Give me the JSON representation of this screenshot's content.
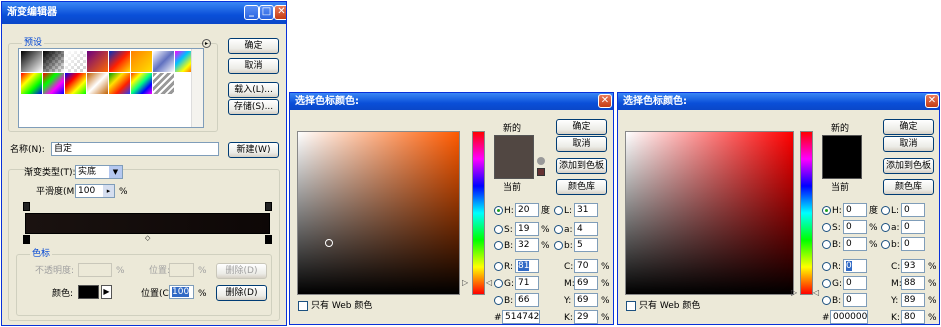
{
  "gradient_editor": {
    "title": "渐变编辑器",
    "presets_label": "预设",
    "buttons": {
      "ok": "确定",
      "cancel": "取消",
      "load": "载入(L)...",
      "save": "存储(S)...",
      "new": "新建(W)"
    },
    "name_label": "名称(N):",
    "name_value": "自定",
    "type_label": "渐变类型(T):",
    "type_value": "实底",
    "smooth_label": "平滑度(M):",
    "smooth_value": "100",
    "smooth_unit": "%",
    "stops_group": "色标",
    "opacity_label": "不透明度:",
    "opacity_unit": "%",
    "position_label": "位置:",
    "position_unit": "%",
    "delete_label": "删除(D)",
    "color_label": "颜色:",
    "color_position_label": "位置(C):",
    "color_position_value": "100",
    "color_position_unit": "%",
    "delete2_label": "删除(D)"
  },
  "picker1": {
    "title": "选择色标颜色:",
    "new_label": "新的",
    "current_label": "当前",
    "new_color": "#514742",
    "current_color": "#514742",
    "buttons": {
      "ok": "确定",
      "cancel": "取消",
      "swatches": "添加到色板",
      "libraries": "颜色库"
    },
    "H": "20",
    "S": "19",
    "B": "32",
    "R": "81",
    "G": "71",
    "Bv": "66",
    "L": "31",
    "a": "4",
    "b": "5",
    "C": "70",
    "M": "69",
    "Y": "69",
    "K": "29",
    "hex": "514742",
    "web_only": "只有 Web 颜色",
    "deg": "度",
    "pct": "%"
  },
  "picker2": {
    "title": "选择色标颜色:",
    "new_label": "新的",
    "current_label": "当前",
    "new_color": "#000000",
    "current_color": "#000000",
    "buttons": {
      "ok": "确定",
      "cancel": "取消",
      "swatches": "添加到色板",
      "libraries": "颜色库"
    },
    "H": "0",
    "S": "0",
    "B": "0",
    "R": "0",
    "G": "0",
    "Bv": "0",
    "L": "0",
    "a": "0",
    "b": "0",
    "C": "93",
    "M": "88",
    "Y": "89",
    "K": "80",
    "hex": "000000",
    "web_only": "只有 Web 颜色",
    "deg": "度",
    "pct": "%"
  },
  "labels": {
    "H": "H:",
    "S": "S:",
    "B": "B:",
    "R": "R:",
    "G": "G:",
    "Bv": "B:",
    "L": "L:",
    "a": "a:",
    "b": "b:",
    "C": "C:",
    "M": "M:",
    "Y": "Y:",
    "K": "K:",
    "hash": "#"
  },
  "icons": {
    "close": "close-icon",
    "minimize": "minimize-icon",
    "maximize": "maximize-icon",
    "menu": "menu-arrow-icon",
    "dropdown": "chevron-down-icon",
    "warning": "warning-icon"
  }
}
